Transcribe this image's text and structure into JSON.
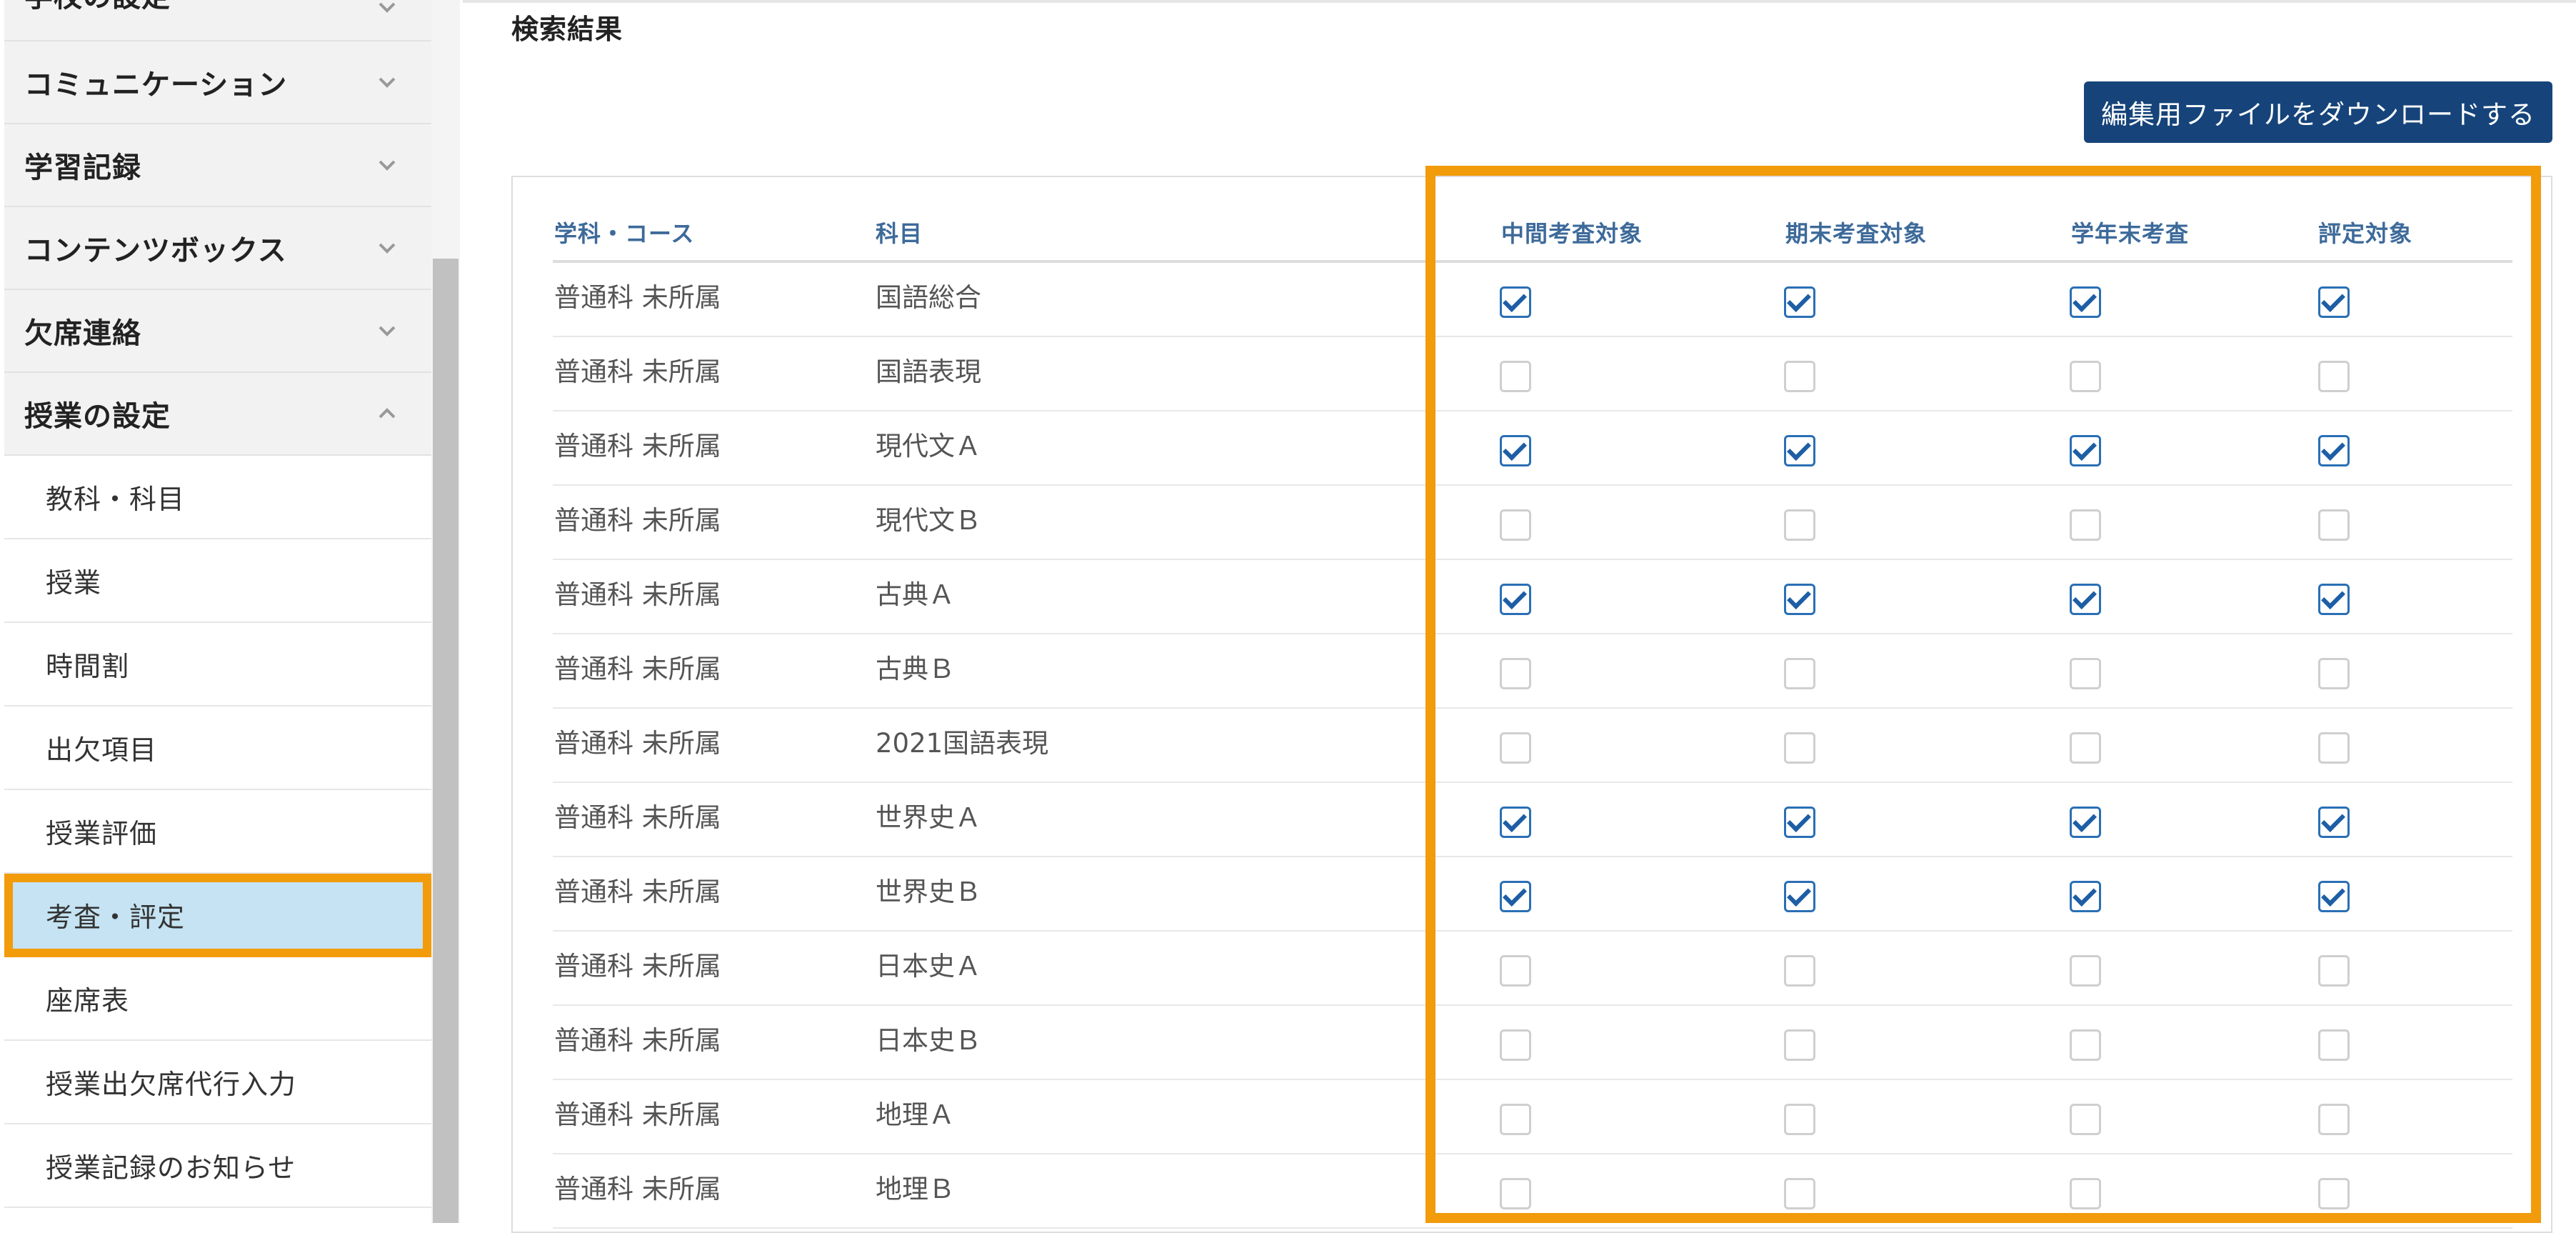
{
  "sidebar": {
    "groups_top": [
      {
        "label": "学校の設定",
        "expanded": false
      },
      {
        "label": "コミュニケーション",
        "expanded": false
      },
      {
        "label": "学習記録",
        "expanded": false
      },
      {
        "label": "コンテンツボックス",
        "expanded": false
      },
      {
        "label": "欠席連絡",
        "expanded": false
      },
      {
        "label": "授業の設定",
        "expanded": true
      }
    ],
    "sub_items": [
      {
        "label": "教科・科目",
        "active": false
      },
      {
        "label": "授業",
        "active": false
      },
      {
        "label": "時間割",
        "active": false
      },
      {
        "label": "出欠項目",
        "active": false
      },
      {
        "label": "授業評価",
        "active": false
      },
      {
        "label": "考査・評定",
        "active": true
      },
      {
        "label": "座席表",
        "active": false
      },
      {
        "label": "授業出欠席代行入力",
        "active": false
      },
      {
        "label": "授業記録のお知らせ",
        "active": false
      }
    ]
  },
  "main": {
    "section_title": "検索結果",
    "download_button": "編集用ファイルをダウンロードする",
    "table": {
      "headers": {
        "course": "学科・コース",
        "subject": "科目",
        "midterm": "中間考査対象",
        "final": "期末考査対象",
        "year_end": "学年末考査",
        "evaluation": "評定対象"
      },
      "rows": [
        {
          "course": "普通科 未所属",
          "subject": "国語総合",
          "checks": [
            true,
            true,
            true,
            true
          ]
        },
        {
          "course": "普通科 未所属",
          "subject": "国語表現",
          "checks": [
            false,
            false,
            false,
            false
          ]
        },
        {
          "course": "普通科 未所属",
          "subject": "現代文Ａ",
          "checks": [
            true,
            true,
            true,
            true
          ]
        },
        {
          "course": "普通科 未所属",
          "subject": "現代文Ｂ",
          "checks": [
            false,
            false,
            false,
            false
          ]
        },
        {
          "course": "普通科 未所属",
          "subject": "古典Ａ",
          "checks": [
            true,
            true,
            true,
            true
          ]
        },
        {
          "course": "普通科 未所属",
          "subject": "古典Ｂ",
          "checks": [
            false,
            false,
            false,
            false
          ]
        },
        {
          "course": "普通科 未所属",
          "subject": "2021国語表現",
          "checks": [
            false,
            false,
            false,
            false
          ]
        },
        {
          "course": "普通科 未所属",
          "subject": "世界史Ａ",
          "checks": [
            true,
            true,
            true,
            true
          ]
        },
        {
          "course": "普通科 未所属",
          "subject": "世界史Ｂ",
          "checks": [
            true,
            true,
            true,
            true
          ]
        },
        {
          "course": "普通科 未所属",
          "subject": "日本史Ａ",
          "checks": [
            false,
            false,
            false,
            false
          ]
        },
        {
          "course": "普通科 未所属",
          "subject": "日本史Ｂ",
          "checks": [
            false,
            false,
            false,
            false
          ]
        },
        {
          "course": "普通科 未所属",
          "subject": "地理Ａ",
          "checks": [
            false,
            false,
            false,
            false
          ]
        },
        {
          "course": "普通科 未所属",
          "subject": "地理Ｂ",
          "checks": [
            false,
            false,
            false,
            false
          ]
        }
      ]
    }
  },
  "colors": {
    "highlight": "#f29b0b",
    "active_item_bg": "#c5e3f2",
    "button_bg": "#16447a",
    "header_text": "#3d6a9a",
    "checkbox_check": "#1d5ea5"
  },
  "icons": {
    "collapsed": "chevron-down-icon",
    "expanded": "chevron-up-icon",
    "checked": "checkbox-checked-icon",
    "unchecked": "checkbox-unchecked-icon"
  }
}
